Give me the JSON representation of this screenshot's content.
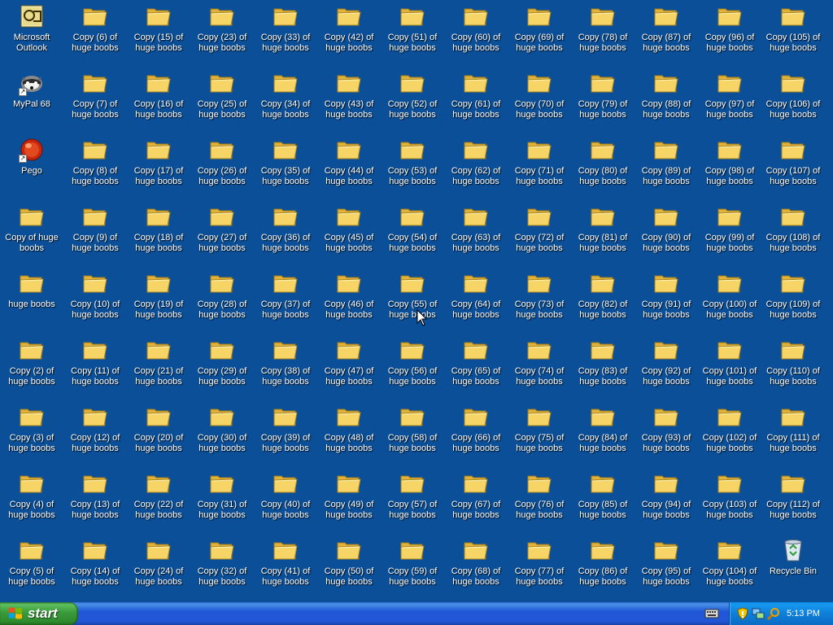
{
  "desktop": {
    "special": [
      {
        "name": "microsoft-outlook-icon",
        "type": "outlook",
        "label": "Microsoft Outlook",
        "col": 0,
        "row": 0
      },
      {
        "name": "mypal-icon",
        "type": "mypal",
        "label": "MyPal 68",
        "col": 0,
        "row": 1
      },
      {
        "name": "pego-icon",
        "type": "pego",
        "label": "Pego",
        "col": 0,
        "row": 2
      },
      {
        "name": "recycle-bin-icon",
        "type": "recycle",
        "label": "Recycle Bin",
        "col": 12,
        "row": 8
      }
    ],
    "folder_columns": [
      [
        "Copy of huge boobs",
        "huge boobs",
        "Copy (2) of huge boobs",
        "Copy (3) of huge boobs",
        "Copy (4) of huge boobs",
        "Copy (5) of huge boobs"
      ],
      [
        "Copy (6) of huge boobs",
        "Copy (7) of huge boobs",
        "Copy (8) of huge boobs",
        "Copy (9) of huge boobs",
        "Copy (10) of huge boobs",
        "Copy (11) of huge boobs",
        "Copy (12) of huge boobs",
        "Copy (13) of huge boobs",
        "Copy (14) of huge boobs"
      ],
      [
        "Copy (15) of huge boobs",
        "Copy (16) of huge boobs",
        "Copy (17) of huge boobs",
        "Copy (18) of huge boobs",
        "Copy (19) of huge boobs",
        "Copy (21) of huge boobs",
        "Copy (20) of huge boobs",
        "Copy (22) of huge boobs",
        "Copy (24) of huge boobs"
      ],
      [
        "Copy (23) of huge boobs",
        "Copy (25) of huge boobs",
        "Copy (26) of huge boobs",
        "Copy (27) of huge boobs",
        "Copy (28) of huge boobs",
        "Copy (29) of huge boobs",
        "Copy (30) of huge boobs",
        "Copy (31) of huge boobs",
        "Copy (32) of huge boobs"
      ],
      [
        "Copy (33) of huge boobs",
        "Copy (34) of huge boobs",
        "Copy (35) of huge boobs",
        "Copy (36) of huge boobs",
        "Copy (37) of huge boobs",
        "Copy (38) of huge boobs",
        "Copy (39) of huge boobs",
        "Copy (40) of huge boobs",
        "Copy (41) of huge boobs"
      ],
      [
        "Copy (42) of huge boobs",
        "Copy (43) of huge boobs",
        "Copy (44) of huge boobs",
        "Copy (45) of huge boobs",
        "Copy (46) of huge boobs",
        "Copy (47) of huge boobs",
        "Copy (48) of huge boobs",
        "Copy (49) of huge boobs",
        "Copy (50) of huge boobs"
      ],
      [
        "Copy (51) of huge boobs",
        "Copy (52) of huge boobs",
        "Copy (53) of huge boobs",
        "Copy (54) of huge boobs",
        "Copy (55) of huge boobs",
        "Copy (56) of huge boobs",
        "Copy (58) of huge boobs",
        "Copy (57) of huge boobs",
        "Copy (59) of huge boobs"
      ],
      [
        "Copy (60) of huge boobs",
        "Copy (61) of huge boobs",
        "Copy (62) of huge boobs",
        "Copy (63) of huge boobs",
        "Copy (64) of huge boobs",
        "Copy (65) of huge boobs",
        "Copy (66) of huge boobs",
        "Copy (67) of huge boobs",
        "Copy (68) of huge boobs"
      ],
      [
        "Copy (69) of huge boobs",
        "Copy (70) of huge boobs",
        "Copy (71) of huge boobs",
        "Copy (72) of huge boobs",
        "Copy (73) of huge boobs",
        "Copy (74) of huge boobs",
        "Copy (75) of huge boobs",
        "Copy (76) of huge boobs",
        "Copy (77) of huge boobs"
      ],
      [
        "Copy (78) of huge boobs",
        "Copy (79) of huge boobs",
        "Copy (80) of huge boobs",
        "Copy (81) of huge boobs",
        "Copy (82) of huge boobs",
        "Copy (83) of huge boobs",
        "Copy (84) of huge boobs",
        "Copy (85) of huge boobs",
        "Copy (86) of huge boobs"
      ],
      [
        "Copy (87) of huge boobs",
        "Copy (88) of huge boobs",
        "Copy (89) of huge boobs",
        "Copy (90) of huge boobs",
        "Copy (91) of huge boobs",
        "Copy (92) of huge boobs",
        "Copy (93) of huge boobs",
        "Copy (94) of huge boobs",
        "Copy (95) of huge boobs"
      ],
      [
        "Copy (96) of huge boobs",
        "Copy (97) of huge boobs",
        "Copy (98) of huge boobs",
        "Copy (99) of huge boobs",
        "Copy (100) of huge boobs",
        "Copy (101) of huge boobs",
        "Copy (102) of huge boobs",
        "Copy (103) of huge boobs",
        "Copy (104) of huge boobs"
      ],
      [
        "Copy (105) of huge boobs",
        "Copy (106) of huge boobs",
        "Copy (107) of huge boobs",
        "Copy (108) of huge boobs",
        "Copy (109) of huge boobs",
        "Copy (110) of huge boobs",
        "Copy (111) of huge boobs",
        "Copy (112) of huge boobs"
      ]
    ]
  },
  "taskbar": {
    "start_label": "start",
    "clock": "5:13 PM"
  },
  "colors": {
    "desktop_background": "#0a4f98",
    "folder_yellow": "#f6d566",
    "start_green": "#3a9a3a",
    "taskbar_blue": "#2157d7",
    "tray_blue": "#0e7fd8"
  }
}
